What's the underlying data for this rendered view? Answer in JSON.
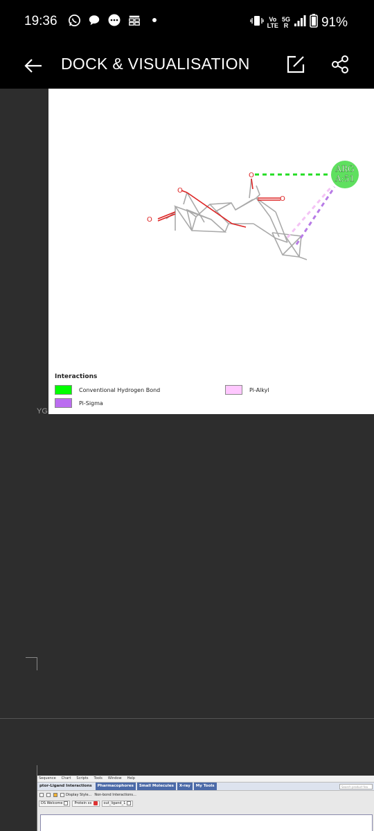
{
  "status_bar": {
    "time": "19:36",
    "icons_left": [
      "whatsapp-icon",
      "chat-bubble-icon",
      "messages-icon",
      "grid-notification-icon",
      "dot-icon"
    ],
    "network_top": "Vo",
    "network_bottom": "LTE",
    "network_5g": "5G",
    "network_r": "R",
    "battery": "91%"
  },
  "app_bar": {
    "title": "DOCK & VISUALISATION"
  },
  "viewer": {
    "residue_line1": "ARG",
    "residue_line2": "A:51",
    "atom_o1": "O",
    "atom_o2": "O",
    "atom_o3": "O",
    "atom_o4": "O",
    "colors": {
      "hbond": "#22dd22",
      "pi_sigma": "#b77be6",
      "pi_alkyl": "#f4c3f5",
      "bond": "#a9a9a9",
      "oxygen_bond": "#dd2222",
      "residue_fill": "#5fe05f"
    }
  },
  "legend": {
    "title": "Interactions",
    "items": [
      {
        "label": "Conventional Hydrogen Bond",
        "color": "#00ff00"
      },
      {
        "label": "Pi-Sigma",
        "color": "#bb6cf0"
      },
      {
        "label": "Pi-Alkyl",
        "color": "#ffc8ff"
      }
    ]
  },
  "background": {
    "partial_label": "YG"
  },
  "ds_window": {
    "menu": [
      "Sequence",
      "Chart",
      "Scripts",
      "Tools",
      "Window",
      "Help"
    ],
    "tabs": [
      "ptor-Ligand Interactions",
      "Pharmacophores",
      "Small Molecules",
      "X-ray",
      "My Tools"
    ],
    "search_placeholder": "Search product fea",
    "display_style": "Display Style...",
    "non_bond": "Non-bond Interactions...",
    "doc_tabs": [
      "DS Welcome",
      "Protein xx",
      "out_ligand_1"
    ]
  }
}
